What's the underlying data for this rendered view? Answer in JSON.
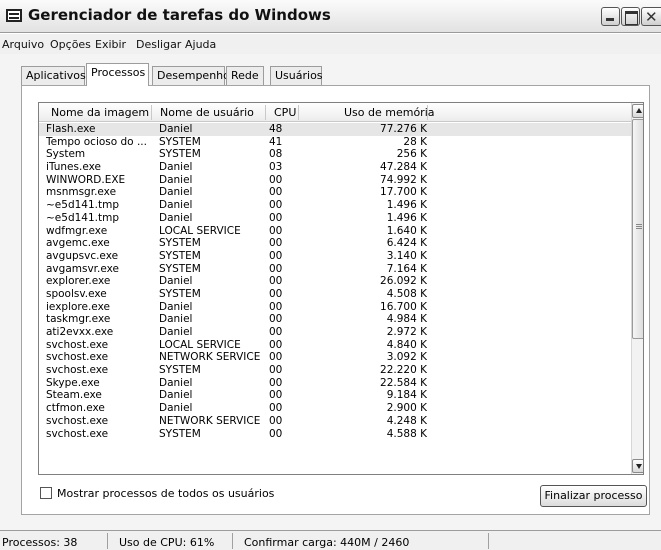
{
  "window": {
    "title": "Gerenciador de tarefas do Windows"
  },
  "menu": [
    "Arquivo",
    "Opções",
    "Exibir",
    "Desligar",
    "Ajuda"
  ],
  "tabs": [
    {
      "label": "Aplicativos",
      "active": false
    },
    {
      "label": "Processos",
      "active": true
    },
    {
      "label": "Desempenho",
      "active": false
    },
    {
      "label": "Rede",
      "active": false
    },
    {
      "label": "Usuários",
      "active": false
    }
  ],
  "columns": {
    "name": "Nome da imagem",
    "user": "Nome de usuário",
    "cpu": "CPU",
    "memory": "Uso de memória"
  },
  "processes": [
    {
      "name": "Flash.exe",
      "user": "Daniel",
      "cpu": "48",
      "mem": "77.276 K",
      "selected": true
    },
    {
      "name": "Tempo ocioso do ...",
      "user": "SYSTEM",
      "cpu": "41",
      "mem": "28 K"
    },
    {
      "name": "System",
      "user": "SYSTEM",
      "cpu": "08",
      "mem": "256 K"
    },
    {
      "name": "iTunes.exe",
      "user": "Daniel",
      "cpu": "03",
      "mem": "47.284 K"
    },
    {
      "name": "WINWORD.EXE",
      "user": "Daniel",
      "cpu": "00",
      "mem": "74.992 K"
    },
    {
      "name": "msnmsgr.exe",
      "user": "Daniel",
      "cpu": "00",
      "mem": "17.700 K"
    },
    {
      "name": "~e5d141.tmp",
      "user": "Daniel",
      "cpu": "00",
      "mem": "1.496 K"
    },
    {
      "name": "~e5d141.tmp",
      "user": "Daniel",
      "cpu": "00",
      "mem": "1.496 K"
    },
    {
      "name": "wdfmgr.exe",
      "user": "LOCAL SERVICE",
      "cpu": "00",
      "mem": "1.640 K"
    },
    {
      "name": "avgemc.exe",
      "user": "SYSTEM",
      "cpu": "00",
      "mem": "6.424 K"
    },
    {
      "name": "avgupsvc.exe",
      "user": "SYSTEM",
      "cpu": "00",
      "mem": "3.140 K"
    },
    {
      "name": "avgamsvr.exe",
      "user": "SYSTEM",
      "cpu": "00",
      "mem": "7.164 K"
    },
    {
      "name": "explorer.exe",
      "user": "Daniel",
      "cpu": "00",
      "mem": "26.092 K"
    },
    {
      "name": "spoolsv.exe",
      "user": "SYSTEM",
      "cpu": "00",
      "mem": "4.508 K"
    },
    {
      "name": "iexplore.exe",
      "user": "Daniel",
      "cpu": "00",
      "mem": "16.700 K"
    },
    {
      "name": "taskmgr.exe",
      "user": "Daniel",
      "cpu": "00",
      "mem": "4.984 K"
    },
    {
      "name": "ati2evxx.exe",
      "user": "Daniel",
      "cpu": "00",
      "mem": "2.972 K"
    },
    {
      "name": "svchost.exe",
      "user": "LOCAL SERVICE",
      "cpu": "00",
      "mem": "4.840 K"
    },
    {
      "name": "svchost.exe",
      "user": "NETWORK SERVICE",
      "cpu": "00",
      "mem": "3.092 K"
    },
    {
      "name": "svchost.exe",
      "user": "SYSTEM",
      "cpu": "00",
      "mem": "22.220 K"
    },
    {
      "name": "Skype.exe",
      "user": "Daniel",
      "cpu": "00",
      "mem": "22.584 K"
    },
    {
      "name": "Steam.exe",
      "user": "Daniel",
      "cpu": "00",
      "mem": "9.184 K"
    },
    {
      "name": "ctfmon.exe",
      "user": "Daniel",
      "cpu": "00",
      "mem": "2.900 K"
    },
    {
      "name": "svchost.exe",
      "user": "NETWORK SERVICE",
      "cpu": "00",
      "mem": "4.248 K"
    },
    {
      "name": "svchost.exe",
      "user": "SYSTEM",
      "cpu": "00",
      "mem": "4.588 K"
    }
  ],
  "show_all_label": "Mostrar processos de todos os usuários",
  "end_process_label": "Finalizar processo",
  "status": {
    "processes": "Processos: 38",
    "cpu": "Uso de CPU: 61%",
    "commit": "Confirmar carga: 440M / 2460"
  },
  "icons": [
    "app-icon",
    "minimize-icon",
    "maximize-icon",
    "close-icon",
    "scroll-up-icon",
    "scroll-down-icon"
  ]
}
